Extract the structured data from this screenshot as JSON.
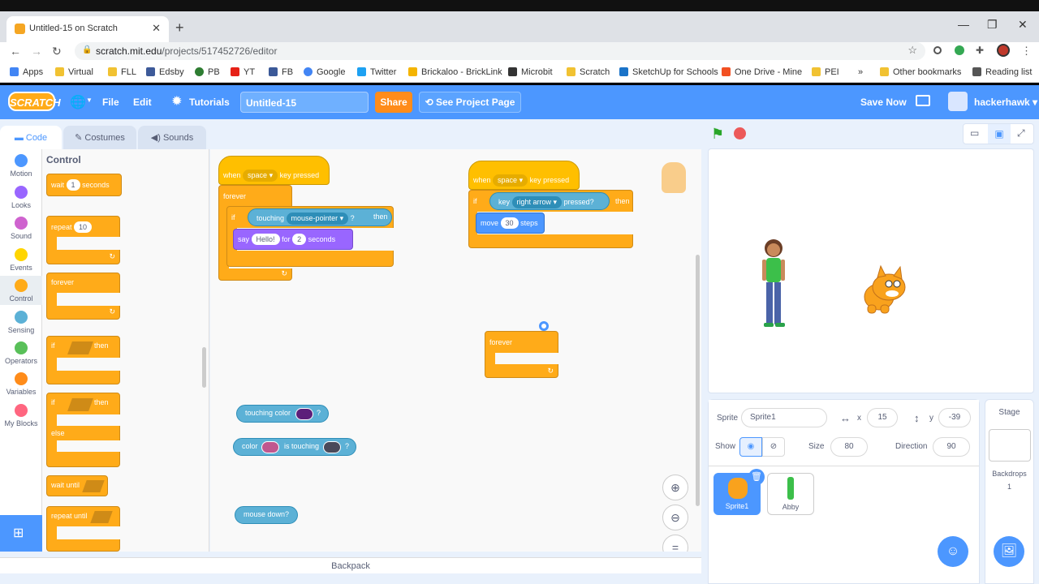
{
  "browser": {
    "tab_title": "Untitled-15 on Scratch",
    "url_host": "scratch.mit.edu",
    "url_path": "/projects/517452726/editor",
    "bookmarks": [
      "Apps",
      "Virtual",
      "FLL",
      "Edsby",
      "PB",
      "YT",
      "FB",
      "Google",
      "Twitter",
      "Brickaloo - BrickLink",
      "Microbit",
      "Scratch",
      "SketchUp for Schools",
      "One Drive - Mine",
      "PEI",
      "»",
      "Other bookmarks",
      "Reading list"
    ]
  },
  "menubar": {
    "logo": "SCRATCH",
    "file": "File",
    "edit": "Edit",
    "tutorials": "Tutorials",
    "project_title": "Untitled-15",
    "share": "Share",
    "see_project": "See Project Page",
    "save_now": "Save Now",
    "username": "hackerhawk"
  },
  "tabs": {
    "code": "Code",
    "costumes": "Costumes",
    "sounds": "Sounds"
  },
  "categories": [
    {
      "label": "Motion",
      "color": "#4c97ff"
    },
    {
      "label": "Looks",
      "color": "#9966ff"
    },
    {
      "label": "Sound",
      "color": "#cf63cf"
    },
    {
      "label": "Events",
      "color": "#ffd500"
    },
    {
      "label": "Control",
      "color": "#ffab19"
    },
    {
      "label": "Sensing",
      "color": "#5cb1d6"
    },
    {
      "label": "Operators",
      "color": "#59c059"
    },
    {
      "label": "Variables",
      "color": "#ff8c1a"
    },
    {
      "label": "My Blocks",
      "color": "#ff6680"
    }
  ],
  "palette": {
    "heading": "Control",
    "wait": "wait",
    "wait_val": "1",
    "seconds": "seconds",
    "repeat": "repeat",
    "repeat_val": "10",
    "forever": "forever",
    "if": "if",
    "then": "then",
    "else": "else",
    "wait_until": "wait until",
    "repeat_until": "repeat until"
  },
  "script1": {
    "when": "when",
    "key": "space",
    "key_pressed": "key pressed",
    "forever": "forever",
    "if": "if",
    "touching": "touching",
    "touch_target": "mouse-pointer",
    "q": "?",
    "then": "then",
    "say": "say",
    "say_text": "Hello!",
    "for": "for",
    "secs": "2",
    "seconds": "seconds"
  },
  "script2": {
    "when": "when",
    "key": "space",
    "key_pressed": "key pressed",
    "if": "if",
    "key_word": "key",
    "key2": "right arrow",
    "pressed": "pressed?",
    "then": "then",
    "move": "move",
    "steps_val": "30",
    "steps": "steps"
  },
  "loose": {
    "forever": "forever",
    "touching_color": "touching color",
    "q": "?",
    "color": "color",
    "is_touching": "is touching",
    "mouse_down": "mouse down?",
    "color_swatch1": "#5c1f7a",
    "color_swatch2": "#c0578f",
    "color_swatch3": "#4a4a5a"
  },
  "sprite_info": {
    "sprite_label": "Sprite",
    "sprite_name": "Sprite1",
    "x_label": "x",
    "x": "15",
    "y_label": "y",
    "y": "-39",
    "show_label": "Show",
    "size_label": "Size",
    "size": "80",
    "direction_label": "Direction",
    "direction": "90"
  },
  "sprites": [
    {
      "name": "Sprite1"
    },
    {
      "name": "Abby"
    }
  ],
  "stage_panel": {
    "title": "Stage",
    "backdrops_label": "Backdrops",
    "backdrops_count": "1"
  },
  "backpack": "Backpack"
}
